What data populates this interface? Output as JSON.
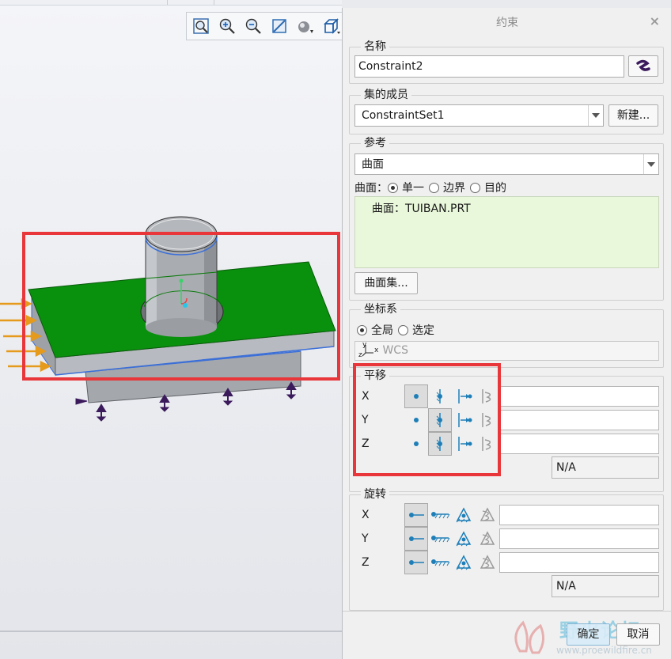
{
  "toolbar": {
    "icons": [
      "zoom-fit-icon",
      "zoom-in-icon",
      "zoom-out-icon",
      "repaint-icon",
      "shading-icon",
      "view-cube-icon"
    ]
  },
  "dialog": {
    "title": "约束",
    "close_glyph": "×",
    "name_group": {
      "legend": "名称",
      "value": "Constraint2"
    },
    "set_group": {
      "legend": "集的成员",
      "value": "ConstraintSet1",
      "new_button": "新建..."
    },
    "ref_group": {
      "legend": "参考",
      "type_value": "曲面",
      "surface_label": "曲面：",
      "options": [
        {
          "label": "单一",
          "selected": true
        },
        {
          "label": "边界",
          "selected": false
        },
        {
          "label": "目的",
          "selected": false
        }
      ],
      "selected_item": "曲面：TUIBAN.PRT",
      "surface_set_button": "曲面集..."
    },
    "csys_group": {
      "legend": "坐标系",
      "options": [
        {
          "label": "全局",
          "selected": true
        },
        {
          "label": "选定",
          "selected": false
        }
      ],
      "csys_value": "WCS",
      "csys_axis_y": "y",
      "csys_axis_z": "z",
      "csys_axis_x": "x"
    },
    "translation_group": {
      "legend": "平移",
      "rows": [
        {
          "axis": "X",
          "selected": 0
        },
        {
          "axis": "Y",
          "selected": 1
        },
        {
          "axis": "Z",
          "selected": 1
        }
      ],
      "na_value": "N/A"
    },
    "rotation_group": {
      "legend": "旋转",
      "rows": [
        {
          "axis": "X",
          "selected": 0
        },
        {
          "axis": "Y",
          "selected": 0
        },
        {
          "axis": "Z",
          "selected": 0
        }
      ],
      "na_value": "N/A"
    },
    "ok_button": "确定",
    "cancel_button": "取消"
  },
  "watermark": {
    "text": "野火论坛",
    "url": "www.proewildfire.cn"
  },
  "colors": {
    "plate_top": "#09900c",
    "plate_side": "#aeb1b6",
    "highlight": "#e8363a",
    "force_arrow": "#e69a1c",
    "fixture": "#3b1a5c",
    "list_bg": "#e9f8da"
  }
}
